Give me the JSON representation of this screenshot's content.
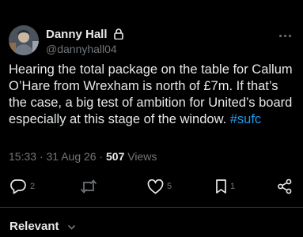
{
  "author": {
    "name": "Danny Hall",
    "handle": "@dannyhall04",
    "protected_icon": "lock-icon"
  },
  "post": {
    "text_before_hashtag": "Hearing the total package on the table for Callum O’Hare from Wrexham is north of £7m. If that’s the case, a big test of ambition for United’s board especially at this stage of the window. ",
    "hashtag": "#sufc",
    "time": "15:33",
    "date": "31 Aug 26",
    "views_count": "507",
    "views_label": "Views",
    "separator": "·"
  },
  "actions": {
    "reply_count": "2",
    "repost_count": "",
    "like_count": "5",
    "bookmark_count": "1"
  },
  "replies_sort": {
    "label": "Relevant"
  },
  "colors": {
    "background": "#000000",
    "text": "#e7e9ea",
    "secondary": "#71767b",
    "link": "#1d9bf0",
    "divider": "#2f3336"
  }
}
